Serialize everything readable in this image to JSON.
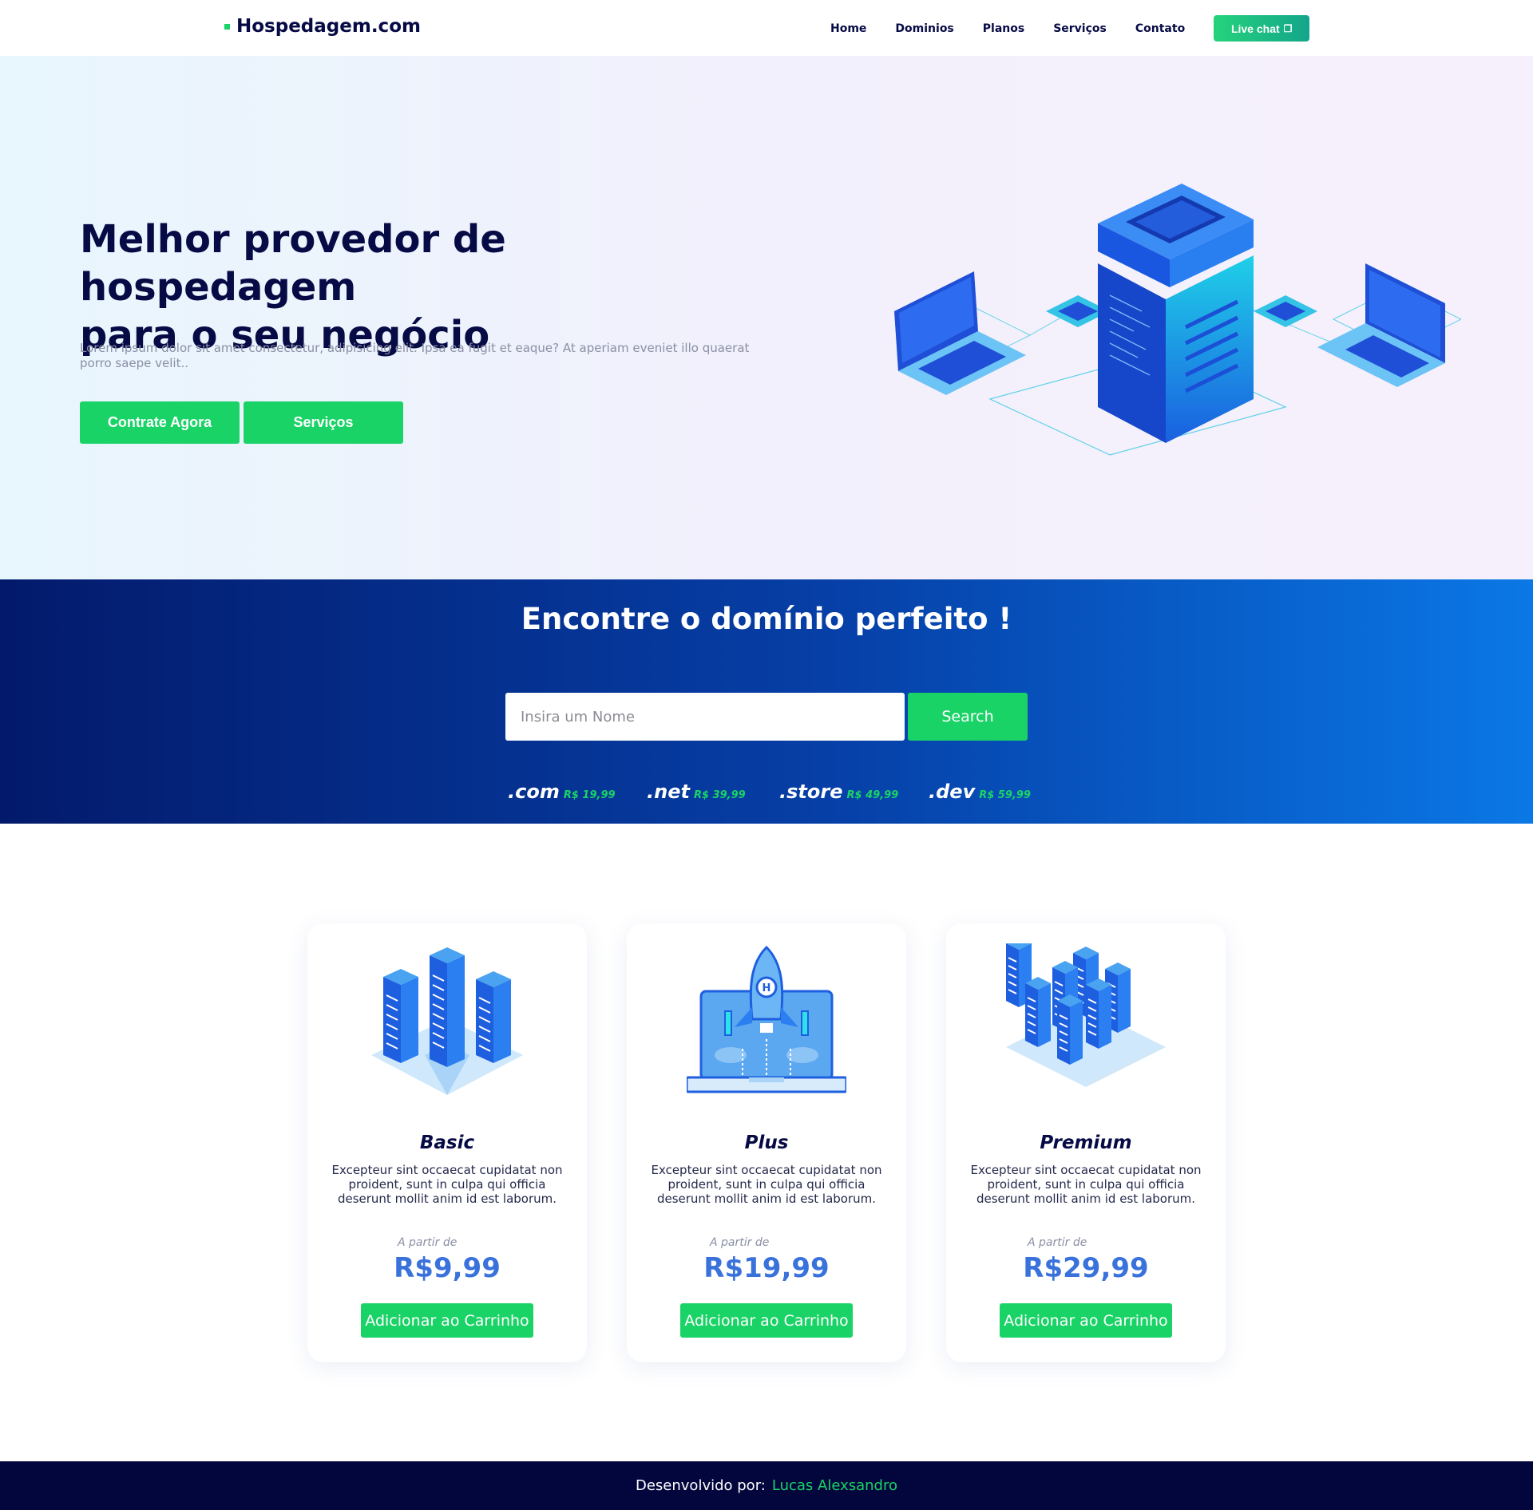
{
  "nav": {
    "logo": "Hospedagem.com",
    "links": [
      "Home",
      "Dominios",
      "Planos",
      "Serviços",
      "Contato"
    ],
    "live_chat": "Live chat"
  },
  "hero": {
    "title_line1": "Melhor provedor de hospedagem",
    "title_line2": "para o seu negócio",
    "text": "Lorem ipsum dolor sit amet consectetur, adipisicing elit. Ipsa ea fugit et eaque? At aperiam eveniet illo quaerat porro saepe velit..",
    "btn_primary": "Contrate Agora",
    "btn_secondary": "Serviços"
  },
  "domain": {
    "title": "Encontre o domínio perfeito !",
    "search_placeholder": "Insira um Nome",
    "search_button": "Search",
    "tlds": [
      {
        "ext": ".com",
        "price": "R$ 19,99"
      },
      {
        "ext": ".net",
        "price": "R$ 39,99"
      },
      {
        "ext": ".store",
        "price": "R$ 49,99"
      },
      {
        "ext": ".dev",
        "price": "R$ 59,99"
      }
    ]
  },
  "plans": [
    {
      "name": "Basic",
      "desc": "Excepteur sint occaecat cupidatat non proident, sunt in culpa qui officia deserunt mollit anim id est laborum.",
      "from": "A partir de",
      "price": "R$9,99",
      "button": "Adicionar ao Carrinho"
    },
    {
      "name": "Plus",
      "desc": "Excepteur sint occaecat cupidatat non proident, sunt in culpa qui officia deserunt mollit anim id est laborum.",
      "from": "A partir de",
      "price": "R$19,99",
      "button": "Adicionar ao Carrinho"
    },
    {
      "name": "Premium",
      "desc": "Excepteur sint occaecat cupidatat non proident, sunt in culpa qui officia deserunt mollit anim id est laborum.",
      "from": "A partir de",
      "price": "R$29,99",
      "button": "Adicionar ao Carrinho"
    }
  ],
  "footer": {
    "text": "Desenvolvido por:",
    "author": "Lucas Alexsandro"
  },
  "colors": {
    "accent_green": "#19d366",
    "navy": "#060a45",
    "price_blue": "#3a72dc"
  }
}
